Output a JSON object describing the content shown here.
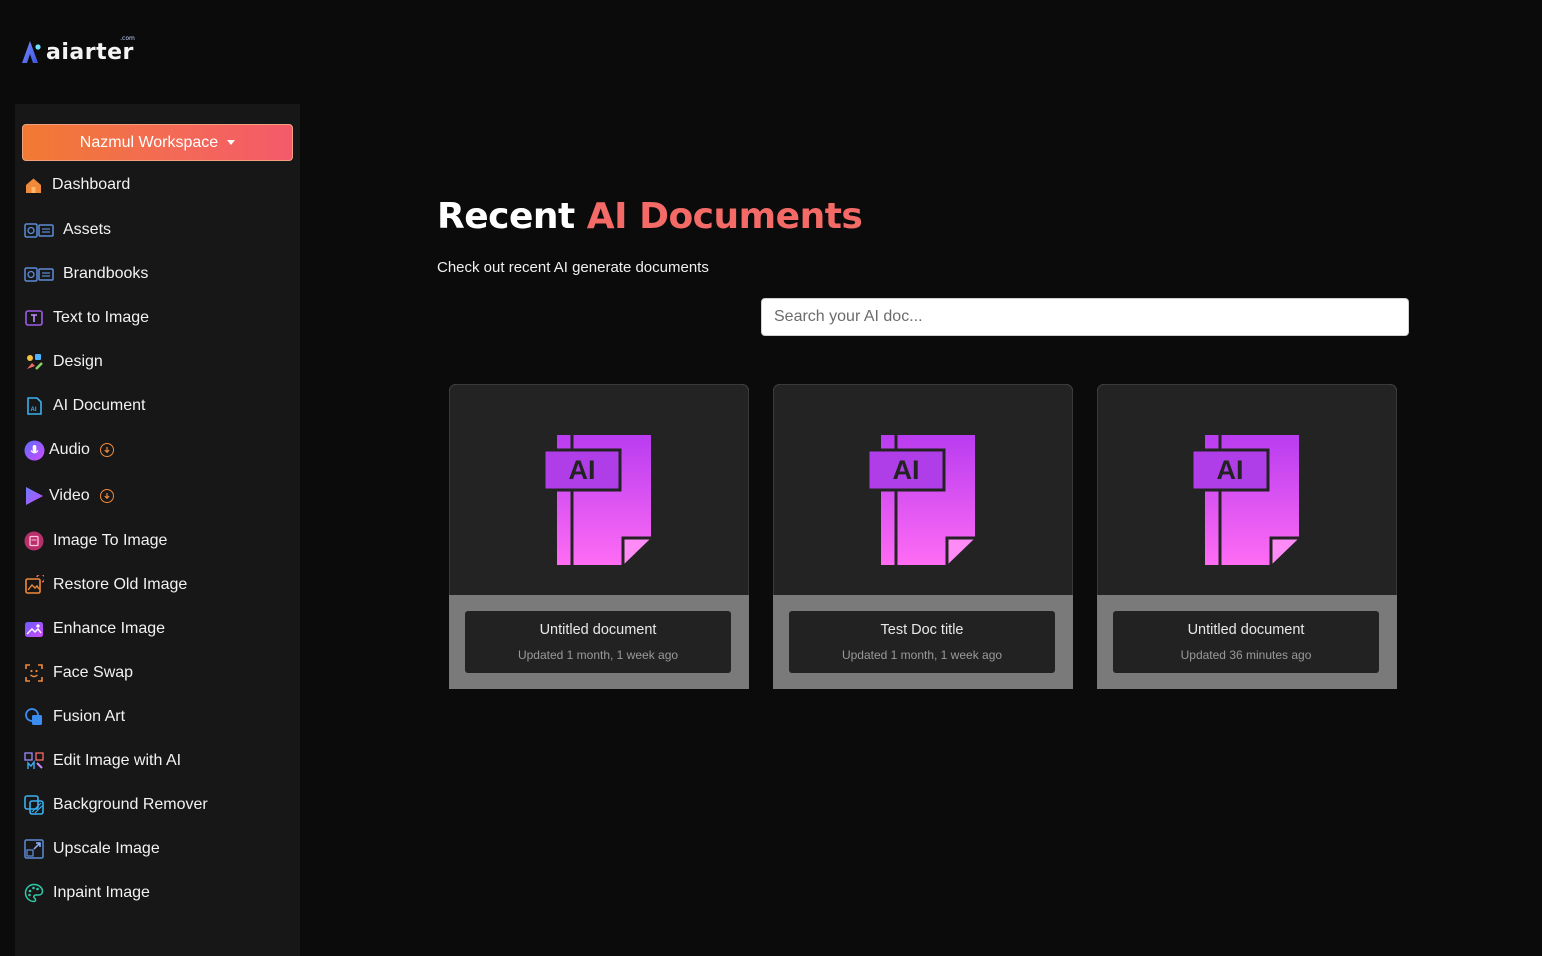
{
  "brand": {
    "name": "aiarter",
    "tld": ".com"
  },
  "workspace": {
    "label": "Nazmul Workspace"
  },
  "sidebar": {
    "items": [
      {
        "label": "Dashboard",
        "icon": "home-icon"
      },
      {
        "label": "Assets",
        "icon": "assets-icon"
      },
      {
        "label": "Brandbooks",
        "icon": "brandbooks-icon"
      },
      {
        "label": "Text to Image",
        "icon": "text-to-image-icon"
      },
      {
        "label": "Design",
        "icon": "design-icon"
      },
      {
        "label": "AI Document",
        "icon": "ai-document-icon"
      },
      {
        "label": "Audio",
        "icon": "audio-icon",
        "badge": "download-icon"
      },
      {
        "label": "Video",
        "icon": "video-icon",
        "badge": "download-icon"
      },
      {
        "label": "Image To Image",
        "icon": "image-to-image-icon"
      },
      {
        "label": "Restore Old Image",
        "icon": "restore-image-icon"
      },
      {
        "label": "Enhance Image",
        "icon": "enhance-image-icon"
      },
      {
        "label": "Face Swap",
        "icon": "face-swap-icon"
      },
      {
        "label": "Fusion Art",
        "icon": "fusion-art-icon"
      },
      {
        "label": "Edit Image with AI",
        "icon": "edit-image-icon"
      },
      {
        "label": "Background Remover",
        "icon": "background-remover-icon"
      },
      {
        "label": "Upscale Image",
        "icon": "upscale-image-icon"
      },
      {
        "label": "Inpaint Image",
        "icon": "inpaint-image-icon"
      }
    ]
  },
  "main": {
    "title_part1": "Recent",
    "title_part2": "AI Documents",
    "subtitle": "Check out recent AI generate documents",
    "search_placeholder": "Search your AI doc...",
    "documents": [
      {
        "title": "Untitled document",
        "updated": "Updated 1 month, 1 week ago",
        "icon_text": "AI"
      },
      {
        "title": "Test Doc title",
        "updated": "Updated 1 month, 1 week ago",
        "icon_text": "AI"
      },
      {
        "title": "Untitled document",
        "updated": "Updated 36 minutes ago",
        "icon_text": "AI"
      }
    ]
  },
  "colors": {
    "accent": "#f46a66",
    "workspace_gradient_start": "#f17a33",
    "workspace_gradient_end": "#f45a6a",
    "doc_icon_top": "#b83cf0",
    "doc_icon_bottom": "#ff6cf4",
    "background": "#0b0b0c",
    "sidebar_bg": "#171718"
  }
}
